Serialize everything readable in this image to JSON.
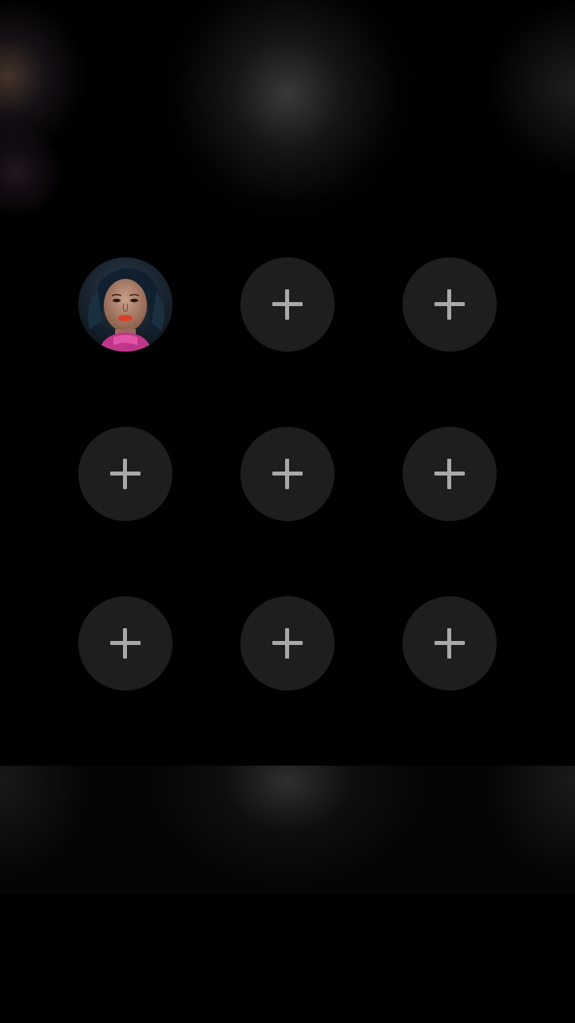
{
  "screen": {
    "background": "#000000"
  },
  "grid": {
    "slots": [
      {
        "id": "slot-1",
        "type": "avatar",
        "icon": "user-avatar"
      },
      {
        "id": "slot-2",
        "type": "add",
        "icon": "plus-icon"
      },
      {
        "id": "slot-3",
        "type": "add",
        "icon": "plus-icon"
      },
      {
        "id": "slot-4",
        "type": "add",
        "icon": "plus-icon"
      },
      {
        "id": "slot-5",
        "type": "add",
        "icon": "plus-icon"
      },
      {
        "id": "slot-6",
        "type": "add",
        "icon": "plus-icon"
      },
      {
        "id": "slot-7",
        "type": "add",
        "icon": "plus-icon"
      },
      {
        "id": "slot-8",
        "type": "add",
        "icon": "plus-icon"
      },
      {
        "id": "slot-9",
        "type": "add",
        "icon": "plus-icon"
      }
    ],
    "slot_color": "#1e1e1e",
    "plus_color": "#a9a9a9"
  }
}
